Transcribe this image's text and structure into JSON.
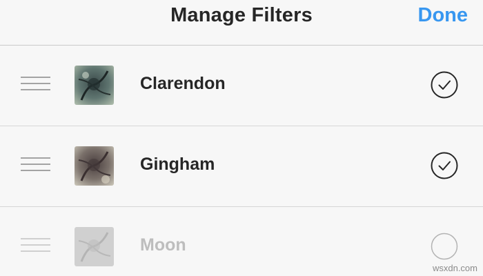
{
  "header": {
    "title": "Manage Filters",
    "done_label": "Done"
  },
  "filters": [
    {
      "name": "Clarendon",
      "selected": true
    },
    {
      "name": "Gingham",
      "selected": true
    },
    {
      "name": "Moon",
      "selected": false
    }
  ],
  "icons": {
    "drag_handle": "drag-handle-icon",
    "check_selected": "checkmark-circle-icon",
    "check_unselected": "empty-circle-icon"
  },
  "colors": {
    "accent": "#3897f0",
    "text": "#262626",
    "disabled_text": "#bdbdbd",
    "divider": "#d6d6d6",
    "background": "#f7f7f7"
  },
  "watermark": "wsxdn.com"
}
